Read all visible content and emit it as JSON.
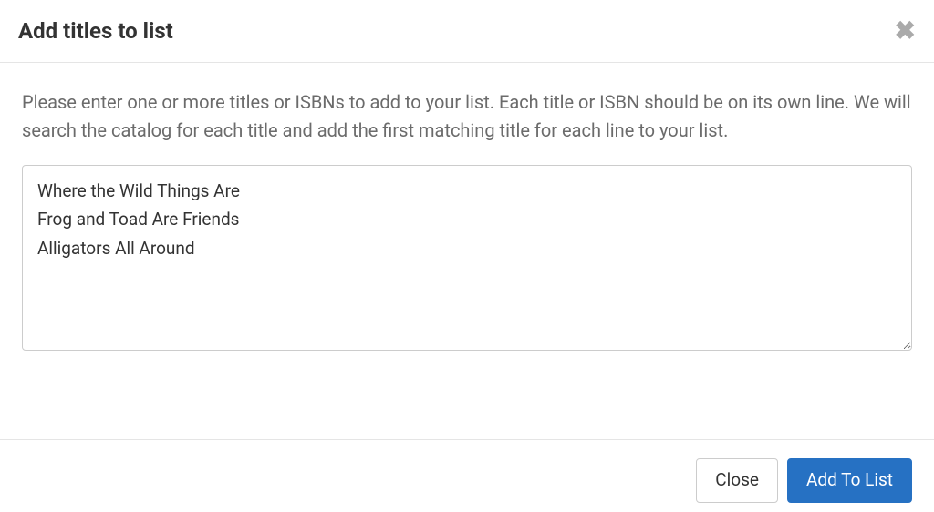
{
  "modal": {
    "title": "Add titles to list",
    "instructions": "Please enter one or more titles or ISBNs to add to your list. Each title or ISBN should be on its own line. We will search the catalog for each title and add the first matching title for each line to your list.",
    "textarea_value": "Where the Wild Things Are\nFrog and Toad Are Friends\nAlligators All Around",
    "close_label": "Close",
    "submit_label": "Add To List"
  }
}
